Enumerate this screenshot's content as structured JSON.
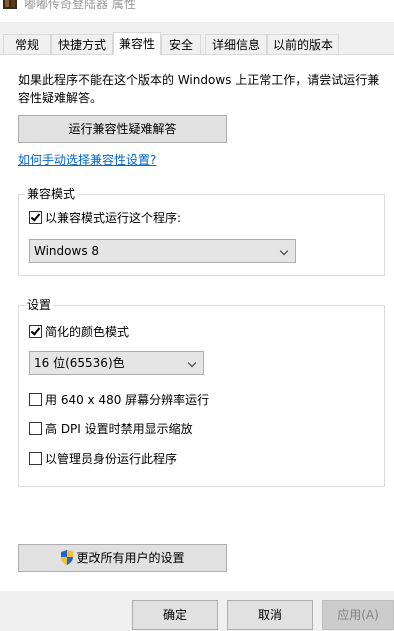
{
  "window": {
    "title": "嘟嘟传奇登陆器 属性"
  },
  "tabs": [
    {
      "label": "常规"
    },
    {
      "label": "快捷方式"
    },
    {
      "label": "兼容性"
    },
    {
      "label": "安全"
    },
    {
      "label": "详细信息"
    },
    {
      "label": "以前的版本"
    }
  ],
  "compat": {
    "description": "如果此程序不能在这个版本的 Windows 上正常工作，请尝试运行兼容性疑难解答。",
    "troubleshoot_button": "运行兼容性疑难解答",
    "manual_link": "如何手动选择兼容性设置?"
  },
  "compat_mode": {
    "group_label": "兼容模式",
    "checkbox_label": "以兼容模式运行这个程序:",
    "checked": true,
    "selected_os": "Windows 8"
  },
  "settings": {
    "group_label": "设置",
    "reduced_color": {
      "label": "简化的颜色模式",
      "checked": true
    },
    "color_select": "16 位(65536)色",
    "run_640": {
      "label": "用 640 x 480 屏幕分辨率运行",
      "checked": false
    },
    "high_dpi": {
      "label": "高 DPI 设置时禁用显示缩放",
      "checked": false
    },
    "run_admin": {
      "label": "以管理员身份运行此程序",
      "checked": false
    }
  },
  "all_users_button": "更改所有用户的设置",
  "footer": {
    "ok": "确定",
    "cancel": "取消",
    "apply": "应用(A)"
  },
  "colors": {
    "link": "#0066cc",
    "panel_bg": "#ffffff",
    "window_bg": "#f0f0f0"
  }
}
